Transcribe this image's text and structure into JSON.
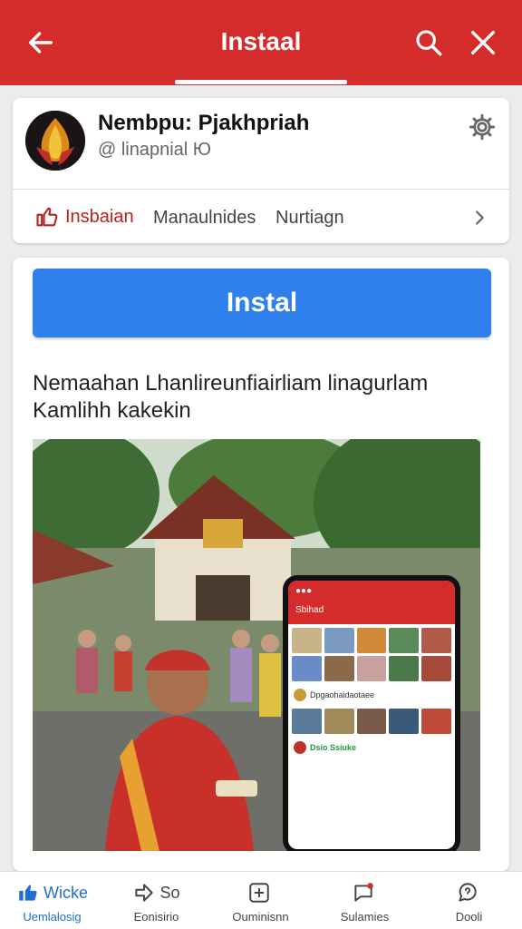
{
  "appbar": {
    "title": "Instaal",
    "back_icon": "arrow-left-icon",
    "search_icon": "search-icon",
    "close_icon": "close-icon"
  },
  "profile": {
    "name": "Nembpu: Pjakhpriah",
    "handle": "@ linapnial Ю",
    "settings_icon": "gear-icon",
    "tabs": [
      {
        "label": "Insbaian",
        "icon": "thumbs-up-icon"
      },
      {
        "label": "Manaulnides"
      },
      {
        "label": "Nurtiagn"
      }
    ]
  },
  "main": {
    "install_label": "Instal",
    "description": "Nemaahan Lhanlireunfiairliam linagurlam Kamlihh kakekin",
    "phone": {
      "header_title": "Sbihad",
      "row1": "Dpgaohaidaotaee",
      "row2": "Dsio Ssiuke"
    }
  },
  "bottom_nav": [
    {
      "top": "Wicke",
      "label": "Uemlalosig",
      "icon": "thumbs-up-icon"
    },
    {
      "top": "So",
      "label": "Eonisirio",
      "icon": "share-icon"
    },
    {
      "top": "",
      "label": "Ouminisnn",
      "icon": "add-box-icon"
    },
    {
      "top": "",
      "label": "Sulamies",
      "icon": "chat-bubble-icon"
    },
    {
      "top": "",
      "label": "Dooli",
      "icon": "help-chat-icon"
    }
  ],
  "colors": {
    "brand_red": "#d42b2b",
    "install_blue": "#2f80ed",
    "like_red": "#b8221e"
  }
}
